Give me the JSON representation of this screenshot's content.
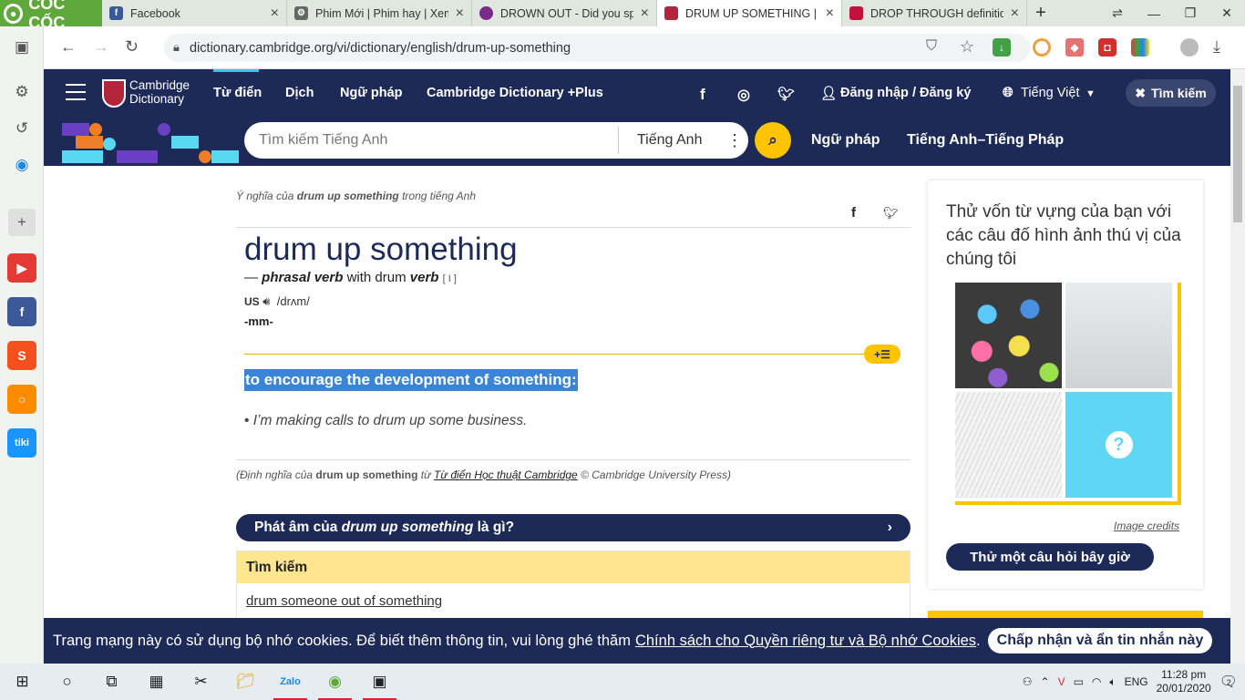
{
  "browser": {
    "brand": "CỐC CỐC",
    "tabs": [
      {
        "title": "Facebook",
        "color": "#3b5998",
        "glyph": "f"
      },
      {
        "title": "Phim Mới | Phim hay | Xem",
        "color": "#555555",
        "glyph": "⚙"
      },
      {
        "title": "DROWN OUT - Did you spe",
        "color": "#7a2a8a",
        "glyph": "●"
      },
      {
        "title": "DRUM UP SOMETHING | Đị",
        "color": "#b2253b",
        "glyph": "▣"
      },
      {
        "title": "DROP THROUGH definition",
        "color": "#c0123c",
        "glyph": "▣"
      }
    ],
    "active_tab": 3,
    "url": "dictionary.cambridge.org/vi/dictionary/english/drum-up-something"
  },
  "site": {
    "logo_line1": "Cambridge",
    "logo_line2": "Dictionary",
    "nav": [
      "Từ điển",
      "Dịch",
      "Ngữ pháp",
      "Cambridge Dictionary +Plus"
    ],
    "login": "Đăng nhập / Đăng ký",
    "language": "Tiếng Việt",
    "search_label": "Tìm kiếm",
    "search_placeholder": "Tìm kiếm Tiếng Anh",
    "search_lang": "Tiếng Anh",
    "sub_links": [
      "Ngữ pháp",
      "Tiếng Anh–Tiếng Pháp"
    ]
  },
  "entry": {
    "meaning_prefix": "Ý nghĩa của",
    "meaning_term": "drum up something",
    "meaning_suffix": "trong tiếng Anh",
    "headword": "drum up something",
    "pos_dash": "—",
    "pos": "phrasal verb",
    "pos_with": "with drum",
    "pos_verb": "verb",
    "grammar": "[ I ]",
    "region": "us",
    "ipa": "/drʌm/",
    "inflection": "-mm-",
    "definition": "to encourage the development of something:",
    "example": "I’m making calls to drum up some business.",
    "source_prefix": "(Định nghĩa của",
    "source_term": "drum up something",
    "source_from": "từ",
    "source_link": "Từ điển Học thuật Cambridge",
    "source_suffix": "© Cambridge University Press)",
    "pron_prefix": "Phát âm của",
    "pron_term": "drum up something",
    "pron_suffix": "là gì?",
    "search_head": "Tìm kiếm",
    "search_link": "drum someone out of something"
  },
  "quiz": {
    "title": "Thử vốn từ vựng của bạn với các câu đố hình ảnh thú vị của chúng tôi",
    "credits": "Image credits",
    "button": "Thử một câu hỏi bây giờ"
  },
  "cookie": {
    "text": "Trang mạng này có sử dụng bộ nhớ cookies. Để biết thêm thông tin, vui lòng ghé thăm",
    "link": "Chính sách cho Quyền riêng tư và Bộ nhớ Cookies",
    "period": ".",
    "button": "Chấp nhận và ẩn tin nhắn này"
  },
  "taskbar": {
    "lang": "ENG",
    "time": "11:28 pm",
    "date": "20/01/2020",
    "notifications": "2"
  },
  "colors": {
    "navy": "#1d2a57",
    "yellow": "#fec400",
    "highlight": "#3a85d6"
  }
}
